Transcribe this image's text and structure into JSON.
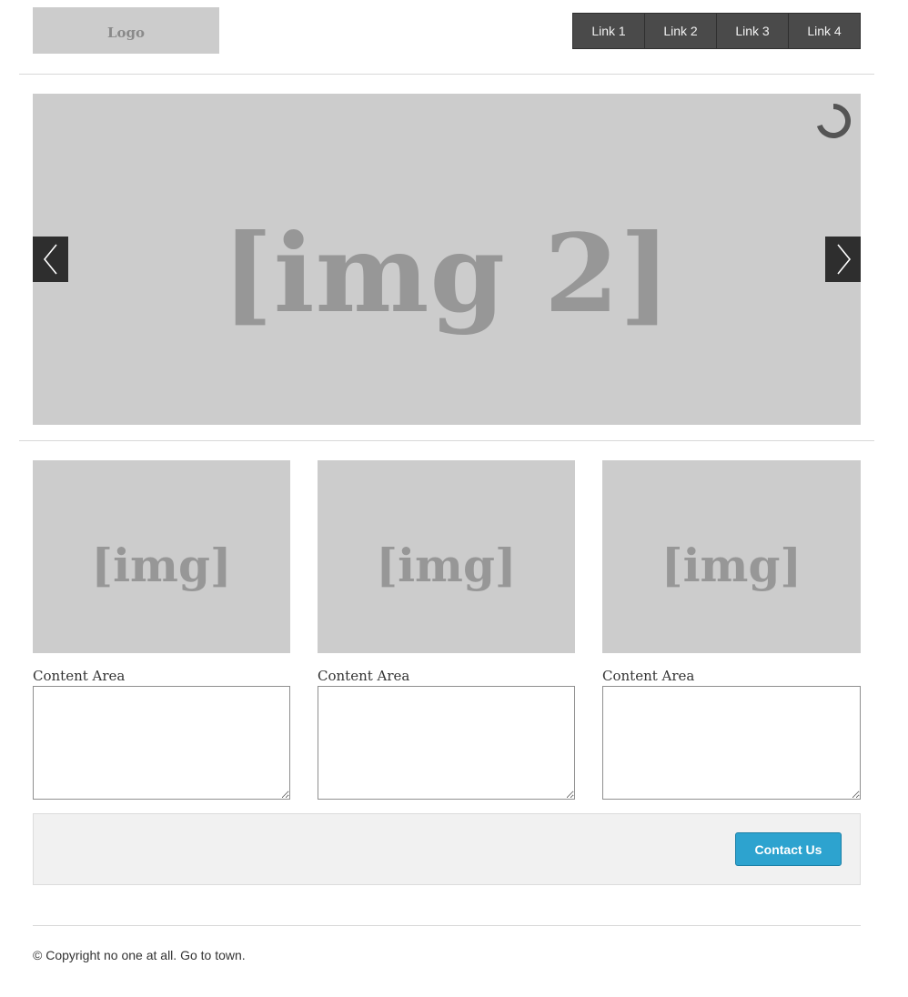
{
  "header": {
    "logo_text": "Logo",
    "nav_links": [
      "Link 1",
      "Link 2",
      "Link 3",
      "Link 4"
    ]
  },
  "slider": {
    "slide_label": "[img 2]",
    "prev_icon": "chevron-left-icon",
    "next_icon": "chevron-right-icon",
    "loading_icon": "spinner-icon"
  },
  "cards": [
    {
      "image_label": "[img]",
      "label": "Content Area"
    },
    {
      "image_label": "[img]",
      "label": "Content Area"
    },
    {
      "image_label": "[img]",
      "label": "Content Area"
    }
  ],
  "contact": {
    "button_label": "Contact Us"
  },
  "footer": {
    "copyright": "© Copyright no one at all. Go to town."
  },
  "colors": {
    "placeholder_bg": "#cccccc",
    "nav_bg": "#4a4a4a",
    "accent": "#2da3cf",
    "panel_bg": "#f1f1f1"
  }
}
